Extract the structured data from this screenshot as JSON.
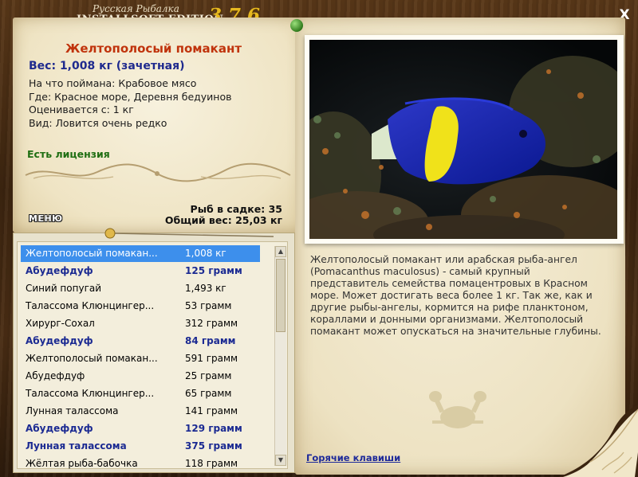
{
  "app": {
    "logo_top": "Русская Рыбалка",
    "logo_main": "INSTALLSOFT EDITION",
    "logo_version": "3.7.6",
    "close_label": "X",
    "menu_label": "МЕНЮ"
  },
  "fish": {
    "title": "Желтополосый помакант",
    "weight_line": "Вес: 1,008 кг (зачетная)",
    "caught_on": "На что поймана: Крабовое мясо",
    "where": "Где: Красное море, Деревня бедуинов",
    "valued_from": "Оценивается с: 1 кг",
    "kind": "Вид: Ловится очень редко",
    "license": "Есть лицензия",
    "description": "Желтополосый помакант или арабская рыба-ангел (Pomacanthus maculosus) - самый крупный представитель семейства помацентровых в Красном море. Может достигать веса более 1 кг. Так же, как и другие рыбы-ангелы, кормится на рифе планктоном, кораллами и донными организмами. Желтополосый помакант может опускаться на значительные глубины."
  },
  "stats": {
    "fish_in_keepnet": "Рыб в садке: 35",
    "total_weight": "Общий вес: 25,03 кг"
  },
  "catch_list": [
    {
      "name": "Желтополосый помакан...",
      "weight": "1,008 кг",
      "style": "selected"
    },
    {
      "name": "Абудефдуф",
      "weight": "125 грамм",
      "style": "bold"
    },
    {
      "name": "Синий попугай",
      "weight": "1,493 кг",
      "style": "normal"
    },
    {
      "name": "Талассома Клюнцингер...",
      "weight": "53 грамм",
      "style": "normal"
    },
    {
      "name": "Хирург-Сохал",
      "weight": "312 грамм",
      "style": "normal"
    },
    {
      "name": "Абудефдуф",
      "weight": "84 грамм",
      "style": "bold"
    },
    {
      "name": "Желтополосый помакан...",
      "weight": "591 грамм",
      "style": "normal"
    },
    {
      "name": "Абудефдуф",
      "weight": "25 грамм",
      "style": "normal"
    },
    {
      "name": "Талассома Клюнцингер...",
      "weight": "65 грамм",
      "style": "normal"
    },
    {
      "name": "Лунная талассома",
      "weight": "141 грамм",
      "style": "normal"
    },
    {
      "name": "Абудефдуф",
      "weight": "129 грамм",
      "style": "bold"
    },
    {
      "name": "Лунная талассома",
      "weight": "375 грамм",
      "style": "bold"
    },
    {
      "name": "Жёлтая рыба-бабочка",
      "weight": "118 грамм",
      "style": "normal"
    }
  ],
  "links": {
    "hotkeys": "Горячие клавиши"
  },
  "colors": {
    "title_red": "#c0330c",
    "weight_blue": "#1f2a8e",
    "license_green": "#1f6e12",
    "selection_blue": "#3d8fec",
    "parchment": "#efe4c4"
  },
  "icons": {
    "close": "close-icon",
    "pin": "green-pin-icon",
    "scroll_up": "arrow-up-icon",
    "scroll_down": "arrow-down-icon"
  }
}
